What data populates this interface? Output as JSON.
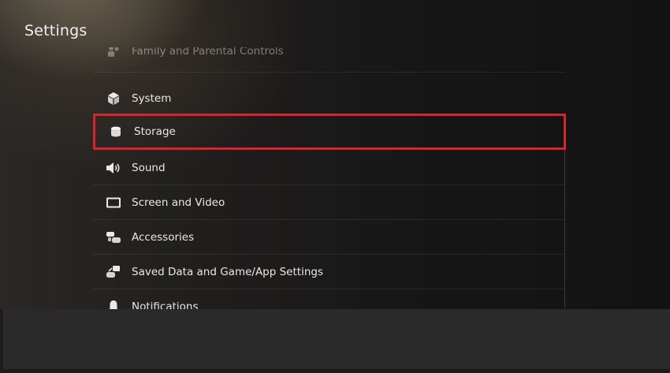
{
  "header": {
    "title": "Settings"
  },
  "menu": {
    "items": [
      {
        "label": "Family and Parental Controls",
        "icon": "family-icon",
        "state": "faded"
      },
      {
        "label": "System",
        "icon": "system-cube-icon",
        "state": "normal"
      },
      {
        "label": "Storage",
        "icon": "storage-cylinder-icon",
        "state": "selected"
      },
      {
        "label": "Sound",
        "icon": "speaker-icon",
        "state": "normal"
      },
      {
        "label": "Screen and Video",
        "icon": "monitor-icon",
        "state": "normal"
      },
      {
        "label": "Accessories",
        "icon": "controllers-icon",
        "state": "normal"
      },
      {
        "label": "Saved Data and Game/App Settings",
        "icon": "saved-data-icon",
        "state": "normal"
      },
      {
        "label": "Notifications",
        "icon": "bell-icon",
        "state": "normal"
      }
    ]
  },
  "colors": {
    "selection_border": "#d9232d",
    "text": "#e8e8e8",
    "bottom_bar": "#2a2a2a"
  }
}
